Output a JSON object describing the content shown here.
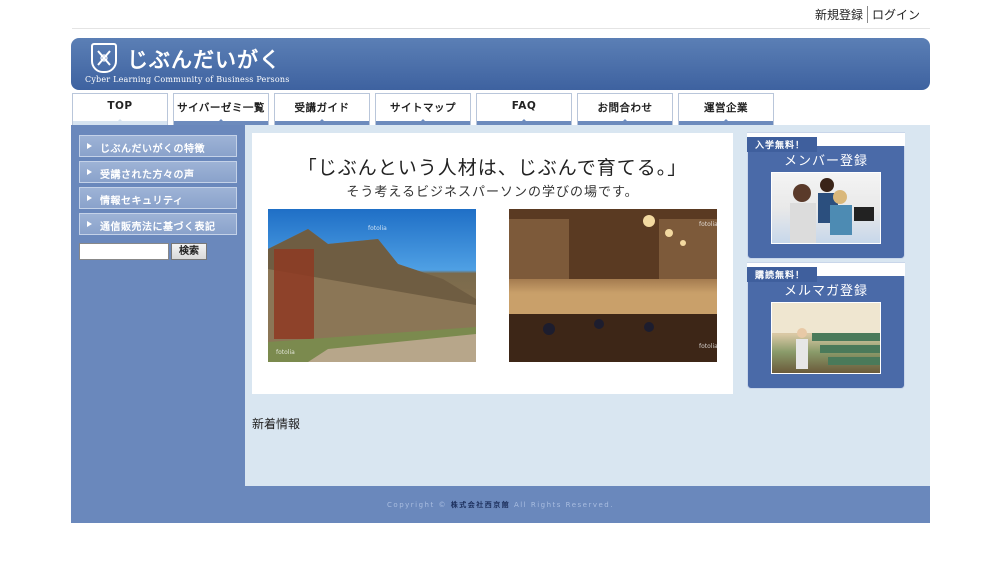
{
  "top_links": {
    "register": "新規登録",
    "login": "ログイン"
  },
  "brand": {
    "title": "じぶんだいがく",
    "subtitle": "Cyber Learning Community of Business Persons"
  },
  "nav": [
    {
      "label": "TOP",
      "active": true
    },
    {
      "label": "サイバーゼミ一覧"
    },
    {
      "label": "受講ガイド"
    },
    {
      "label": "サイトマップ"
    },
    {
      "label": "FAQ"
    },
    {
      "label": "お問合わせ"
    },
    {
      "label": "運営企業"
    }
  ],
  "sidebar": {
    "items": [
      {
        "label": "じぶんだいがくの特徴"
      },
      {
        "label": "受講された方々の声"
      },
      {
        "label": "情報セキュリティ"
      },
      {
        "label": "通信販売法に基づく表記"
      }
    ],
    "search_button": "検索"
  },
  "hero": {
    "line1": "「じぶんという人材は、じぶんで育てる。」",
    "line2": "そう考えるビジネスパーソンの学びの場です。",
    "watermark": "fotolia"
  },
  "news": {
    "title": "新着情報"
  },
  "promos": [
    {
      "tag": "入学無料！",
      "title": "メンバー登録"
    },
    {
      "tag": "購読無料！",
      "title": "メルマガ登録"
    }
  ],
  "footer": {
    "prefix": "Copyright ©",
    "company": "株式会社西京館",
    "suffix": "All Rights Reserved."
  },
  "colors": {
    "header": "#4a6aa8",
    "sidebar": "#6a88bc",
    "main_bg": "#d9e6f1"
  }
}
